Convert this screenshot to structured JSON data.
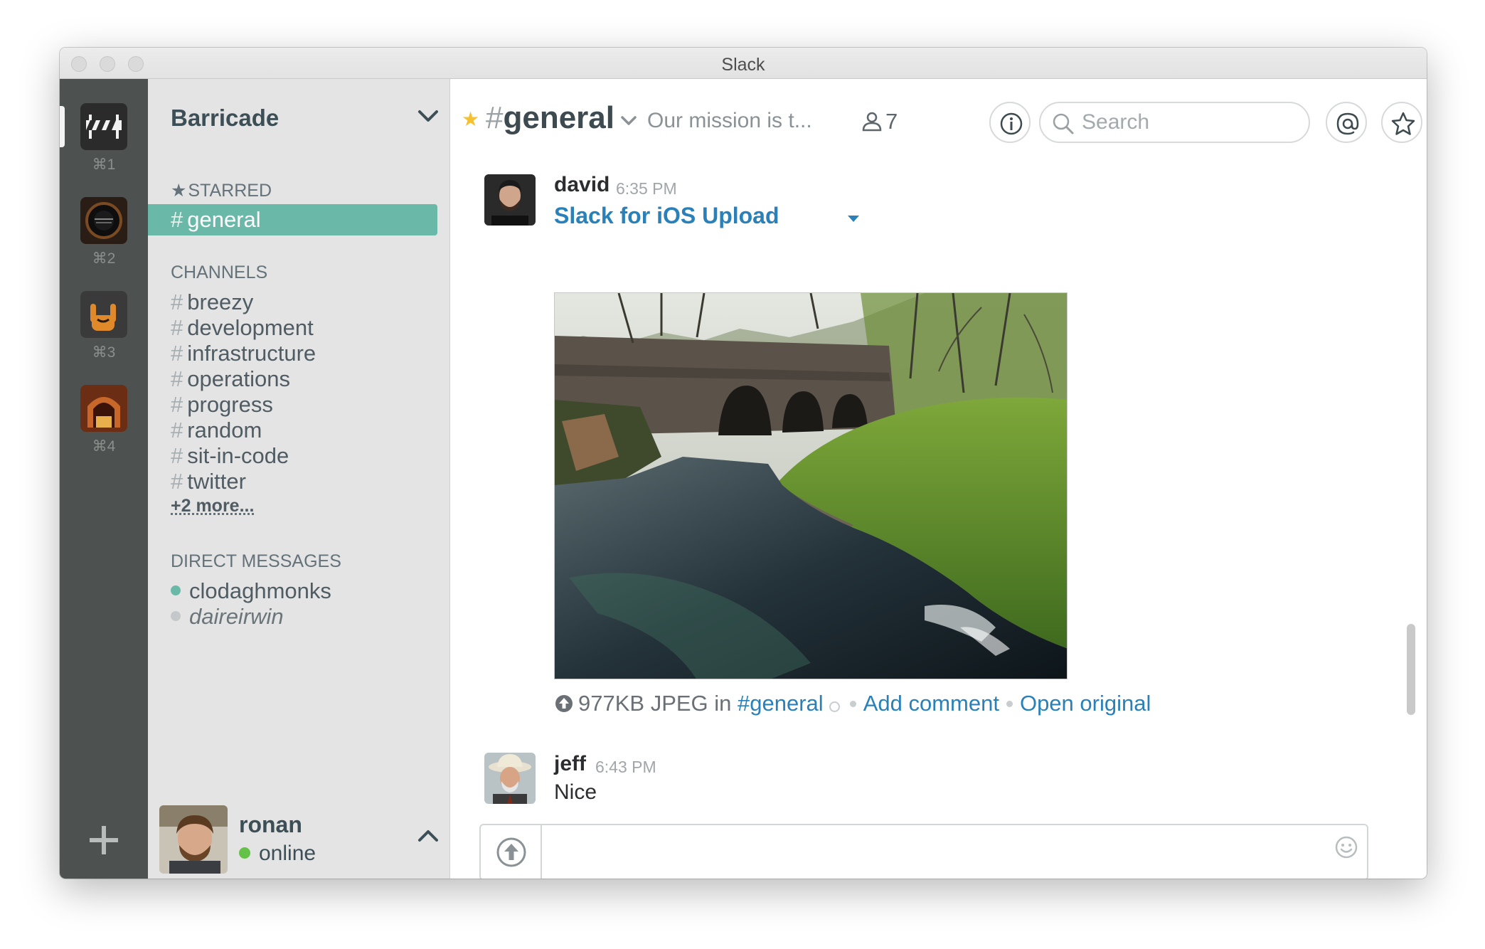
{
  "window": {
    "title": "Slack"
  },
  "teams": [
    {
      "shortcut": "⌘1",
      "active": true
    },
    {
      "shortcut": "⌘2",
      "active": false
    },
    {
      "shortcut": "⌘3",
      "active": false
    },
    {
      "shortcut": "⌘4",
      "active": false
    }
  ],
  "sidebar": {
    "team_name": "Barricade",
    "starred_label": "STARRED",
    "starred": [
      {
        "name": "general",
        "selected": true
      }
    ],
    "channels_label": "CHANNELS",
    "channels": [
      "breezy",
      "development",
      "infrastructure",
      "operations",
      "progress",
      "random",
      "sit-in-code",
      "twitter"
    ],
    "more_link": "+2 more...",
    "dm_label": "DIRECT MESSAGES",
    "direct_messages": [
      {
        "name": "clodaghmonks",
        "online": true
      },
      {
        "name": "daireirwin",
        "online": false
      }
    ],
    "current_user": {
      "name": "ronan",
      "status": "online"
    }
  },
  "header": {
    "hash": "#",
    "channel": "general",
    "purpose": "Our mission is t...",
    "member_count": "7",
    "search_placeholder": "Search"
  },
  "messages": [
    {
      "author": "david",
      "time": "6:35 PM",
      "file": {
        "title": "Slack for iOS Upload",
        "size_type": "977KB JPEG in",
        "channel_link": "#general",
        "add_comment": "Add comment",
        "open_original": "Open original"
      }
    },
    {
      "author": "jeff",
      "time": "6:43 PM",
      "text": "Nice"
    }
  ],
  "colors": {
    "accent_selected": "#6ab9a8",
    "link": "#2a80b9",
    "star": "#f6c12e",
    "presence_online": "#65c249",
    "presence_dm": "#6ab9a8"
  },
  "composer": {
    "value": ""
  }
}
